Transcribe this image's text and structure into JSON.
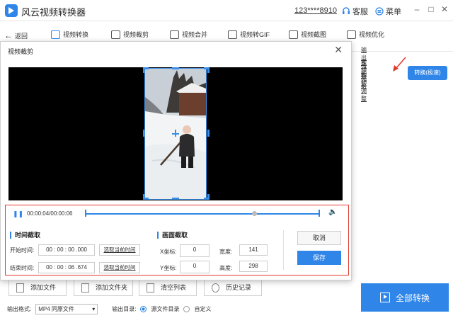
{
  "app": {
    "title": "风云视频转换器",
    "account": "123****8910",
    "service_label": "客服",
    "menu_label": "菜单"
  },
  "toolbar": {
    "back_label": "返回",
    "tools": [
      {
        "label": "视频转换",
        "icon": "video-convert-icon"
      },
      {
        "label": "视频裁剪",
        "icon": "video-crop-icon"
      },
      {
        "label": "视频合并",
        "icon": "video-merge-icon"
      },
      {
        "label": "视频转GIF",
        "icon": "gif-icon"
      },
      {
        "label": "视频截图",
        "icon": "screenshot-icon"
      },
      {
        "label": "视频优化",
        "icon": "optimize-icon"
      }
    ]
  },
  "side_panel": {
    "items": [
      {
        "label": "输出格式"
      },
      {
        "label": "视频裁剪"
      },
      {
        "label": "音频调整"
      }
    ],
    "convert_label": "转换(极速)"
  },
  "dialog": {
    "title": "视频裁剪",
    "player": {
      "time": "00:00:04/00:00:06",
      "progress": 0.72
    },
    "time_section": {
      "title": "时间截取",
      "start_label": "开始时间:",
      "start": {
        "h": "00",
        "m": "00",
        "s": "00",
        "ms": ".000"
      },
      "end_label": "结束时间:",
      "end": {
        "h": "00",
        "m": "00",
        "s": "06",
        "ms": ".674"
      },
      "pick_label": "选取当前时间"
    },
    "frame_section": {
      "title": "画面截取",
      "x_label": "X坐标:",
      "x_value": "0",
      "y_label": "Y坐标:",
      "y_value": "0",
      "w_label": "宽度:",
      "w_value": "141",
      "h_label": "高度:",
      "h_value": "298"
    },
    "cancel_label": "取消",
    "save_label": "保存"
  },
  "bottom": {
    "add_file": "添加文件",
    "add_folder": "添加文件夹",
    "clear_list": "清空列表",
    "history": "历史记录",
    "format_label": "输出格式:",
    "format_value": "MP4 同原文件",
    "dir_label": "输出目录:",
    "dir_source": "源文件目录",
    "dir_custom": "自定义",
    "convert_all": "全部转换"
  },
  "colors": {
    "accent": "#2f86e8",
    "highlight": "#e23b2e"
  }
}
